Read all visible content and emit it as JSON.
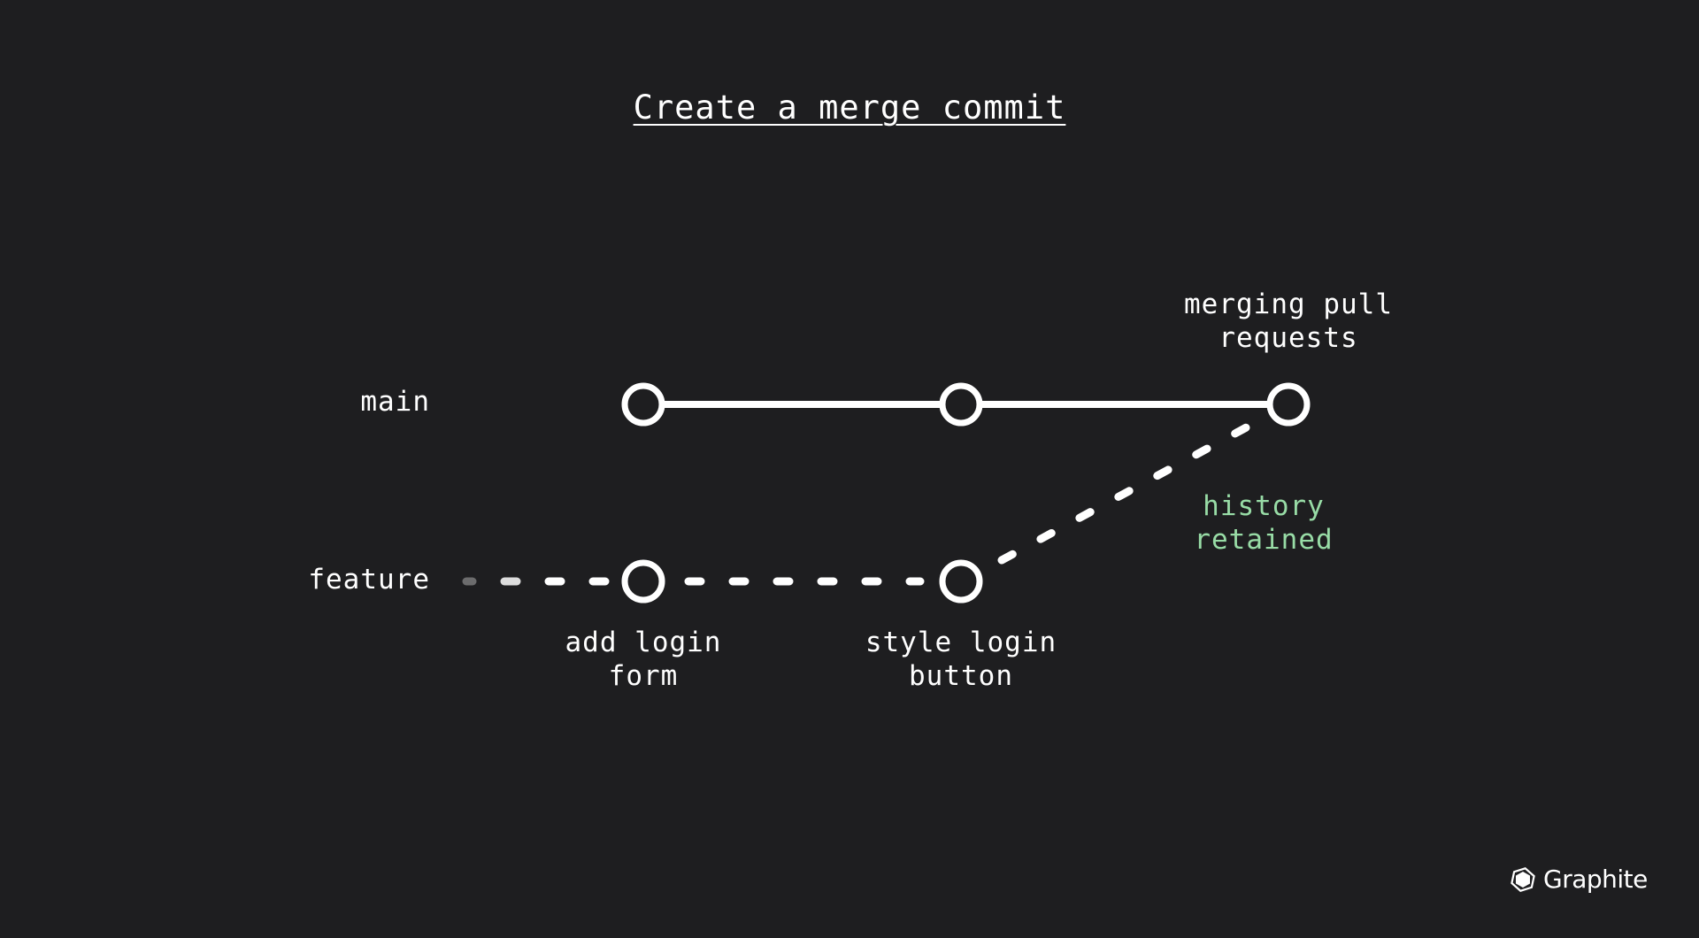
{
  "title": "Create a merge commit",
  "branches": {
    "main": "main",
    "feature": "feature"
  },
  "commits": {
    "main": [
      {
        "id": "main-1",
        "label": ""
      },
      {
        "id": "main-2",
        "label": ""
      },
      {
        "id": "merge",
        "label_line1": "merging pull",
        "label_line2": "requests"
      }
    ],
    "feature": [
      {
        "id": "feature-1",
        "label_line1": "add login",
        "label_line2": "form"
      },
      {
        "id": "feature-2",
        "label_line1": "style login",
        "label_line2": "button"
      }
    ]
  },
  "annotation": {
    "line1": "history",
    "line2": "retained",
    "color": "#98dca6"
  },
  "colors": {
    "background": "#1e1e20",
    "foreground": "#ffffff",
    "accent": "#98dca6"
  },
  "brand": {
    "icon": "graphite-logo-icon",
    "name": "Graphite"
  }
}
